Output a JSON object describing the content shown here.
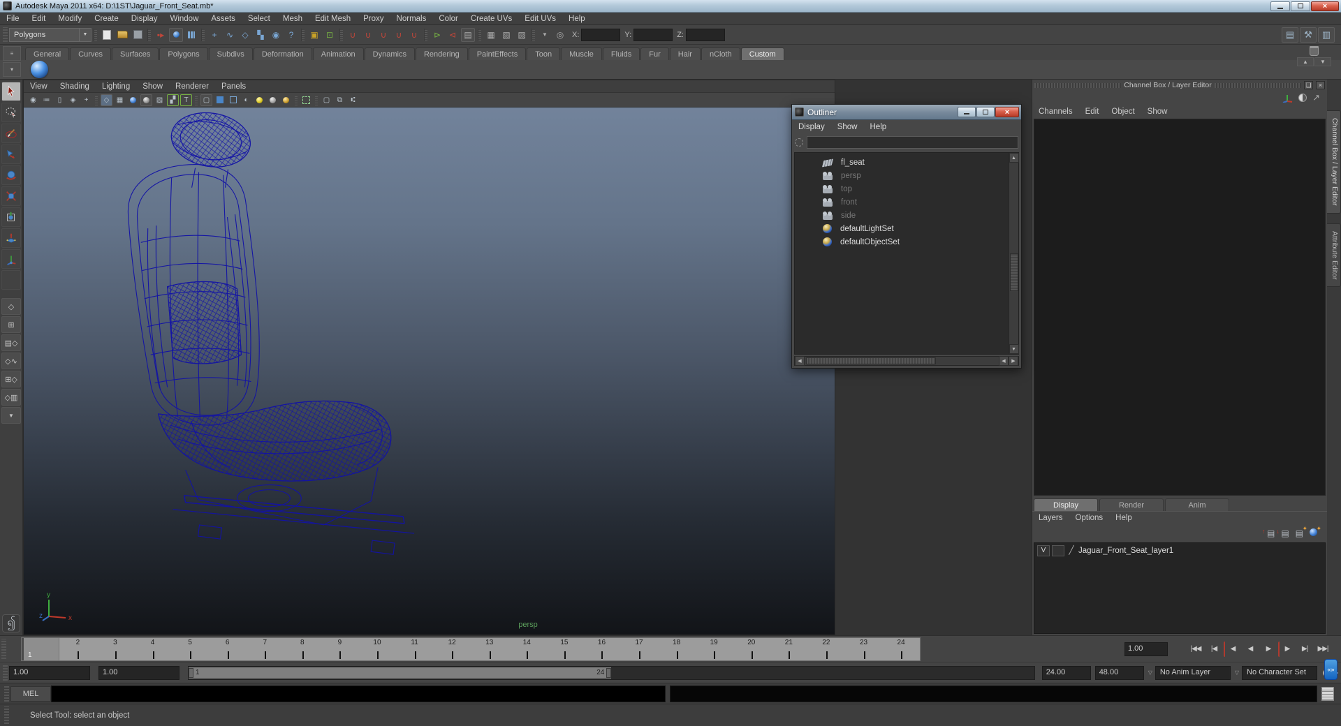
{
  "window": {
    "title": "Autodesk Maya 2011 x64: D:\\1ST\\Jaguar_Front_Seat.mb*",
    "close_glyph": "×"
  },
  "menubar": {
    "items": [
      "File",
      "Edit",
      "Modify",
      "Create",
      "Display",
      "Window",
      "Assets",
      "Select",
      "Mesh",
      "Edit Mesh",
      "Proxy",
      "Normals",
      "Color",
      "Create UVs",
      "Edit UVs",
      "Help"
    ]
  },
  "statusline": {
    "mode_selector": "Polygons",
    "dropdown_glyph": "▼",
    "x_label": "X:",
    "y_label": "Y:",
    "z_label": "Z:",
    "x_value": "",
    "y_value": "",
    "z_value": ""
  },
  "shelf": {
    "tabs": [
      {
        "label": "General"
      },
      {
        "label": "Curves"
      },
      {
        "label": "Surfaces"
      },
      {
        "label": "Polygons"
      },
      {
        "label": "Subdivs"
      },
      {
        "label": "Deformation"
      },
      {
        "label": "Animation"
      },
      {
        "label": "Dynamics"
      },
      {
        "label": "Rendering"
      },
      {
        "label": "PaintEffects"
      },
      {
        "label": "Toon"
      },
      {
        "label": "Muscle"
      },
      {
        "label": "Fluids"
      },
      {
        "label": "Fur"
      },
      {
        "label": "Hair"
      },
      {
        "label": "nCloth"
      },
      {
        "label": "Custom",
        "active": true
      }
    ]
  },
  "viewport": {
    "panel_menus": [
      "View",
      "Shading",
      "Lighting",
      "Show",
      "Renderer",
      "Panels"
    ],
    "camera_label": "persp",
    "axis": {
      "x": "x",
      "y": "y",
      "z": "z"
    },
    "texture_tool_glyph": "T"
  },
  "outliner": {
    "title": "Outliner",
    "close_glyph": "×",
    "menus": [
      "Display",
      "Show",
      "Help"
    ],
    "search_value": "",
    "items": [
      {
        "label": "fl_seat",
        "icon": "mesh"
      },
      {
        "label": "persp",
        "icon": "camera",
        "muted": true
      },
      {
        "label": "top",
        "icon": "camera",
        "muted": true
      },
      {
        "label": "front",
        "icon": "camera",
        "muted": true
      },
      {
        "label": "side",
        "icon": "camera",
        "muted": true
      },
      {
        "label": "defaultLightSet",
        "icon": "set"
      },
      {
        "label": "defaultObjectSet",
        "icon": "set"
      }
    ],
    "scroll": {
      "up": "▲",
      "down": "▼",
      "left": "◀",
      "right": "▶"
    }
  },
  "channel_box": {
    "header": "Channel Box / Layer Editor",
    "float_glyph": "❏",
    "close_glyph": "×",
    "arrow_glyph": "↗",
    "menus": [
      "Channels",
      "Edit",
      "Object",
      "Show"
    ],
    "side_tabs": [
      "Channel Box / Layer Editor",
      "Attribute Editor"
    ]
  },
  "layer_editor": {
    "tabs": [
      {
        "label": "Display",
        "active": true
      },
      {
        "label": "Render"
      },
      {
        "label": "Anim"
      }
    ],
    "menus": [
      "Layers",
      "Options",
      "Help"
    ],
    "layer": {
      "visibility": "V",
      "name": "Jaguar_Front_Seat_layer1"
    }
  },
  "timeline": {
    "frames": [
      "1",
      "2",
      "3",
      "4",
      "5",
      "6",
      "7",
      "8",
      "9",
      "10",
      "11",
      "12",
      "13",
      "14",
      "15",
      "16",
      "17",
      "18",
      "19",
      "20",
      "21",
      "22",
      "23",
      "24"
    ],
    "current_frame": "1",
    "current_time": "1.00",
    "playback": [
      {
        "glyph": "|◀◀"
      },
      {
        "glyph": "|◀"
      },
      {
        "glyph": "◀",
        "red": true
      },
      {
        "glyph": "◀"
      },
      {
        "glyph": "▶"
      },
      {
        "glyph": "▶",
        "red": true
      },
      {
        "glyph": "▶|"
      },
      {
        "glyph": "▶▶|"
      }
    ]
  },
  "range_slider": {
    "animation_start": "1.00",
    "playback_start": "1.00",
    "range_start_label": "1",
    "range_end_label": "24",
    "playback_end": "24.00",
    "animation_end": "48.00",
    "drop_glyph": "▽",
    "anim_layer": "No Anim Layer",
    "character_set": "No Character Set"
  },
  "command_line": {
    "label": "MEL",
    "value": "",
    "response": ""
  },
  "help_line": {
    "text": "Select Tool: select an object"
  },
  "colors": {
    "wireframe": "#1212a6",
    "viewport_top": "#72839b",
    "viewport_bottom": "#121418",
    "timeline_bg": "#9c9c9c",
    "close_button": "#c0392b",
    "persp_label": "#5b9e5b"
  }
}
